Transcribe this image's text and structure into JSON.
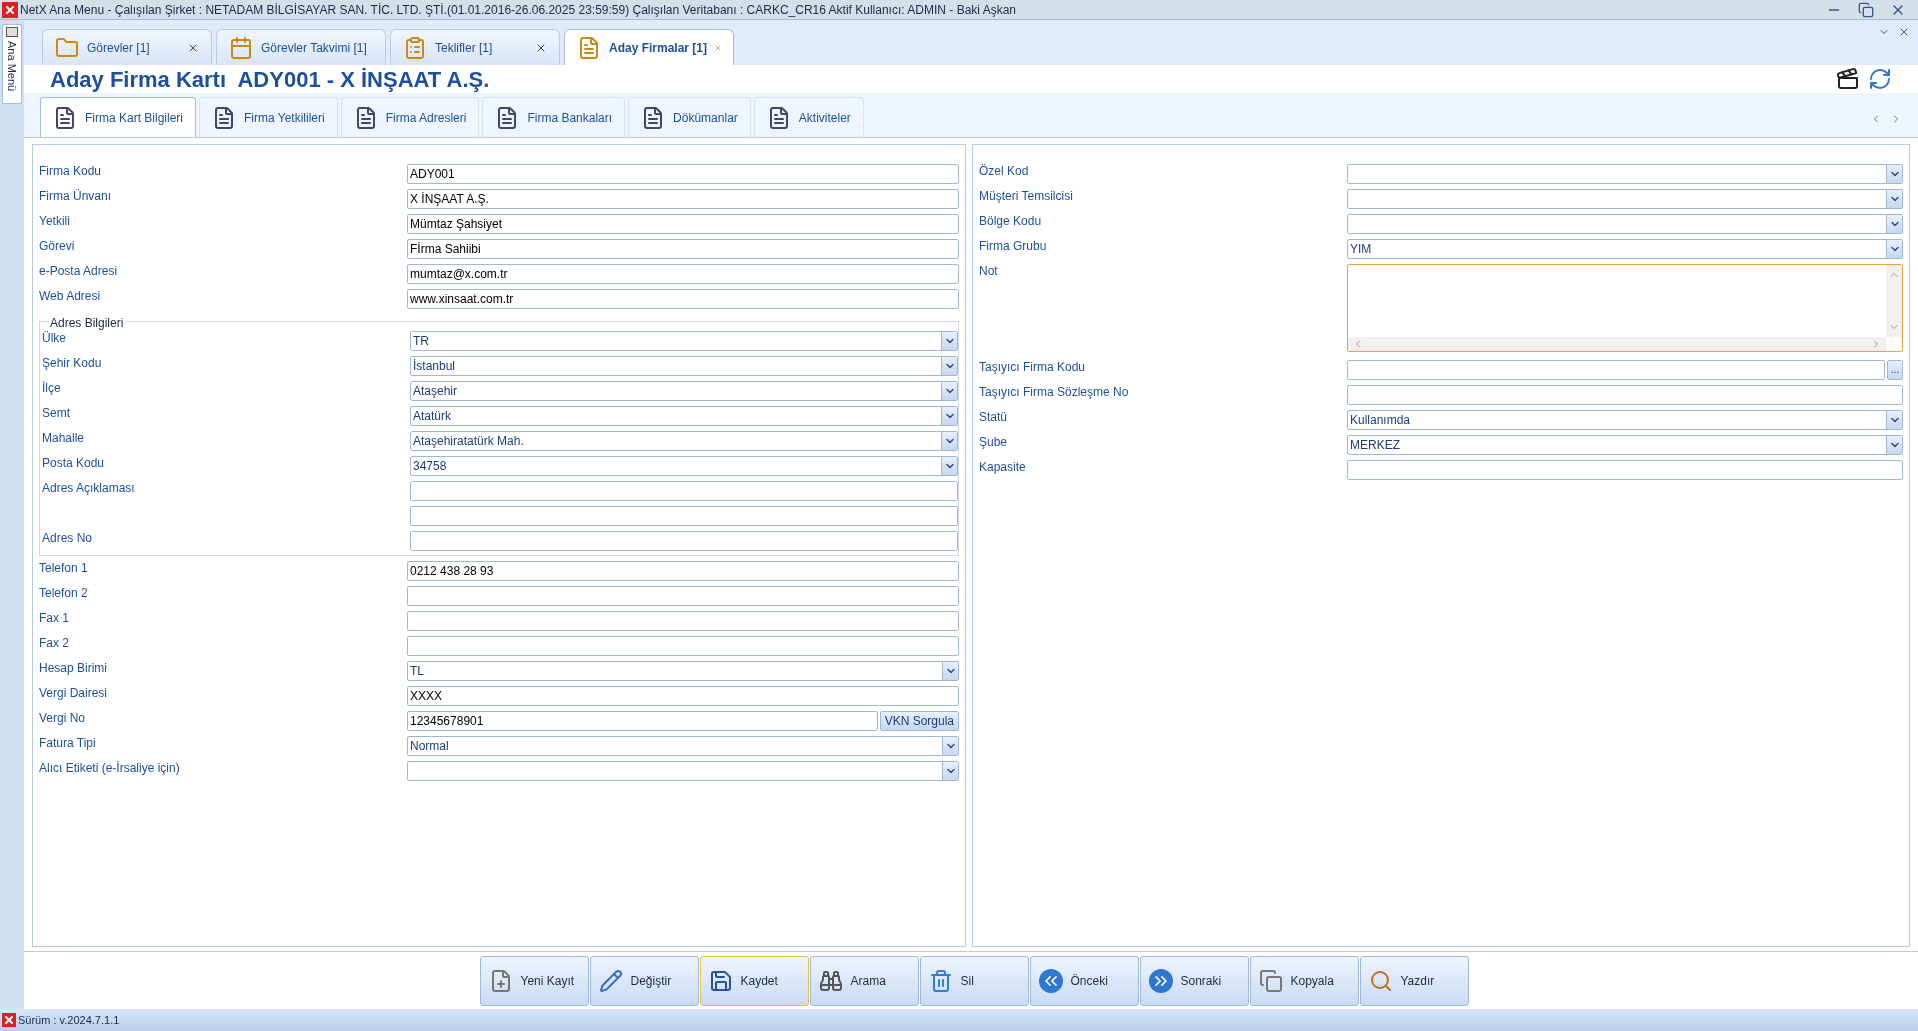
{
  "window": {
    "title": "NetX Ana Menu - Çalışılan Şirket : NETADAM BİLGİSAYAR SAN. TİC. LTD. ŞTİ.(01.01.2016-26.06.2025 23:59:59) Çalışılan Veritabanı : CARKC_CR16  Aktif Kullanıcı: ADMIN - Baki Aşkan"
  },
  "side_menu": {
    "label": "Ana Menü"
  },
  "doc_tabs": [
    {
      "label": "Görevler [1]",
      "selected": false
    },
    {
      "label": "Görevler Takvimi [1]",
      "selected": false
    },
    {
      "label": "Teklifler [1]",
      "selected": false
    },
    {
      "label": "Aday Firmalar [1]",
      "selected": true
    }
  ],
  "header": {
    "title": "Aday Firma Kartı  ADY001 - X İNŞAAT A.Ş."
  },
  "sub_tabs": [
    {
      "label": "Firma Kart Bilgileri",
      "selected": true
    },
    {
      "label": "Firma Yetkilileri",
      "selected": false
    },
    {
      "label": "Firma Adresleri",
      "selected": false
    },
    {
      "label": "Firma Bankaları",
      "selected": false
    },
    {
      "label": "Dökümanlar",
      "selected": false
    },
    {
      "label": "Aktiviteler",
      "selected": false
    }
  ],
  "left_fields": [
    {
      "kind": "text",
      "label": "Firma Kodu",
      "value": "ADY001"
    },
    {
      "kind": "text",
      "label": "Firma Ünvanı",
      "value": "X İNŞAAT A.Ş."
    },
    {
      "kind": "text",
      "label": "Yetkili",
      "value": "Mümtaz Şahsiyet"
    },
    {
      "kind": "text",
      "label": "Görevi",
      "value": "Fİrma Sahiibi"
    },
    {
      "kind": "text",
      "label": "e-Posta Adresi",
      "value": "mumtaz@x.com.tr"
    },
    {
      "kind": "text",
      "label": "Web Adresi",
      "value": "www.xinsaat.com.tr"
    }
  ],
  "address_group": {
    "title": "Adres Bilgileri",
    "fields": [
      {
        "kind": "combo",
        "label": "Ülke",
        "value": "TR"
      },
      {
        "kind": "combo",
        "label": "Şehir Kodu",
        "value": "İstanbul"
      },
      {
        "kind": "combo",
        "label": "İlçe",
        "value": "Ataşehir"
      },
      {
        "kind": "combo",
        "label": "Semt",
        "value": "Atatürk"
      },
      {
        "kind": "combo",
        "label": "Mahalle",
        "value": "Ataşehiratatürk Mah."
      },
      {
        "kind": "combo",
        "label": "Posta Kodu",
        "value": "34758"
      },
      {
        "kind": "text",
        "label": "Adres Açıklaması"
      },
      {
        "kind": "text"
      },
      {
        "kind": "text",
        "label": "Adres No"
      }
    ]
  },
  "left_fields_2": [
    {
      "kind": "text",
      "label": "Telefon 1",
      "value": "0212 438 28 93"
    },
    {
      "kind": "text",
      "label": "Telefon 2"
    },
    {
      "kind": "text",
      "label": "Fax 1"
    },
    {
      "kind": "text",
      "label": "Fax 2"
    },
    {
      "kind": "combo",
      "label": "Hesap Birimi",
      "value": "TL"
    },
    {
      "kind": "text",
      "label": "Vergi Dairesi",
      "value": "XXXX"
    },
    {
      "kind": "action",
      "label": "Vergi No",
      "value": "12345678901",
      "button": "VKN Sorgula"
    },
    {
      "kind": "combo",
      "label": "Fatura Tipi",
      "value": "Normal"
    },
    {
      "kind": "combo",
      "label": "Alıcı Etiketi (e-İrsaliye için)"
    }
  ],
  "right_fields": [
    {
      "kind": "combo",
      "label": "Özel Kod"
    },
    {
      "kind": "combo",
      "label": "Müşteri Temsilcisi"
    },
    {
      "kind": "combo",
      "label": "Bölge Kodu"
    },
    {
      "kind": "combo",
      "label": "Firma Grubu",
      "value": "YIM"
    },
    {
      "kind": "memo",
      "label": "Not"
    },
    {
      "kind": "lookup",
      "label": "Taşıyıcı Firma Kodu",
      "button": "..."
    },
    {
      "kind": "text",
      "label": "Taşıyıcı Firma Sözleşme No"
    },
    {
      "kind": "combo",
      "label": "Statü",
      "value": "Kullanımda"
    },
    {
      "kind": "combo",
      "label": "Şube",
      "value": "MERKEZ"
    },
    {
      "kind": "text",
      "label": "Kapasite"
    }
  ],
  "actions": [
    {
      "label": "Yeni Kayıt",
      "kind": "new",
      "selected": false
    },
    {
      "label": "Değiştir",
      "kind": "edit",
      "selected": false
    },
    {
      "label": "Kaydet",
      "kind": "save",
      "selected": true
    },
    {
      "label": "Arama",
      "kind": "search",
      "selected": false
    },
    {
      "label": "Sil",
      "kind": "delete",
      "selected": false
    },
    {
      "label": "Önceki",
      "kind": "prev",
      "selected": false
    },
    {
      "label": "Sonraki",
      "kind": "next",
      "selected": false
    },
    {
      "label": "Kopyala",
      "kind": "copy",
      "selected": false
    },
    {
      "label": "Yazdır",
      "kind": "print",
      "selected": false
    }
  ],
  "status_bar": {
    "version": "Sürüm : v.2024.7.1.1"
  }
}
